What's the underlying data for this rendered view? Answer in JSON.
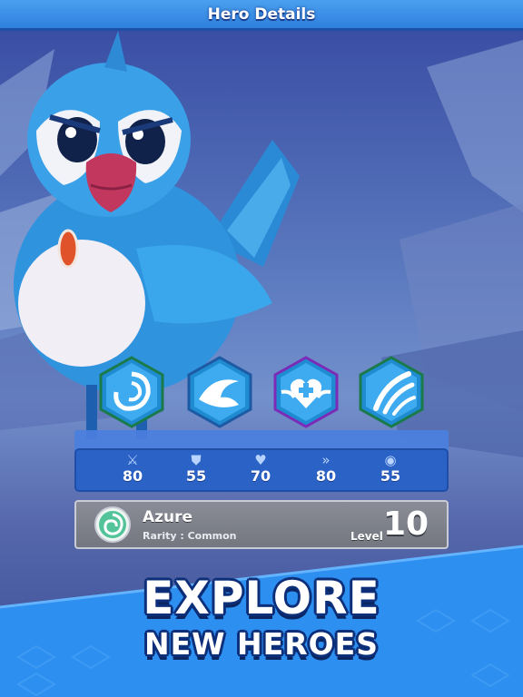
{
  "header": {
    "title": "Hero Details"
  },
  "skills": [
    {
      "icon": "vortex-icon"
    },
    {
      "icon": "wave-icon"
    },
    {
      "icon": "heal-heart-icon"
    },
    {
      "icon": "claw-slash-icon"
    }
  ],
  "stats": [
    {
      "icon": "attack-swords-icon",
      "glyph": "⚔",
      "value": "80"
    },
    {
      "icon": "defense-shield-icon",
      "glyph": "⛊",
      "value": "55"
    },
    {
      "icon": "health-heart-icon",
      "glyph": "♥",
      "value": "70"
    },
    {
      "icon": "speed-chevrons-icon",
      "glyph": "»",
      "value": "80"
    },
    {
      "icon": "accuracy-target-icon",
      "glyph": "◉",
      "value": "55"
    }
  ],
  "hero": {
    "name": "Azure",
    "rarity": "Rarity : Common",
    "level_label": "Level",
    "level": "10"
  },
  "banner": {
    "line1": "EXPLORE",
    "line2": "NEW HEROES"
  },
  "colors": {
    "header": "#3a8fe8",
    "stats_panel": "#2a62c6",
    "banner_blue": "#2d8ff0",
    "card_gray": "#7f828b"
  }
}
